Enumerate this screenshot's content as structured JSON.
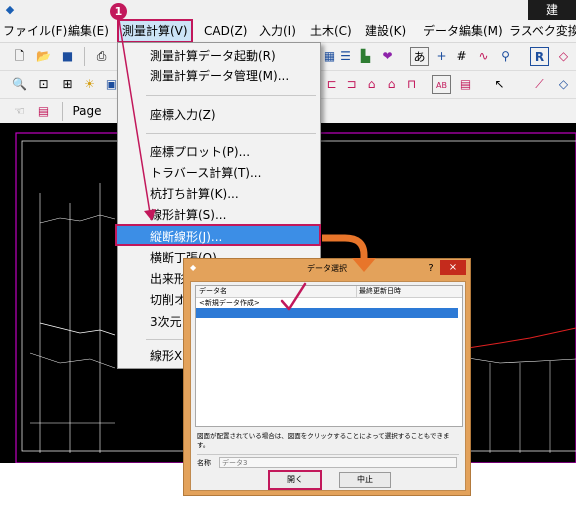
{
  "badge": "1",
  "title_fragment": "建",
  "menubar": [
    {
      "label": "ファイル(F)"
    },
    {
      "label": "編集(E)"
    },
    {
      "label": "測量計算(V)"
    },
    {
      "label": "CAD(Z)"
    },
    {
      "label": "入力(I)"
    },
    {
      "label": "土木(C)"
    },
    {
      "label": "建設(K)"
    },
    {
      "label": "データ編集(M)"
    },
    {
      "label": "ラスベク変換("
    }
  ],
  "toolbar3": {
    "page_label": "Page"
  },
  "dropdown": [
    {
      "label": "測量計算データ起動(R)"
    },
    {
      "label": "測量計算データ管理(M)..."
    },
    {
      "label": "座標入力(Z)"
    },
    {
      "label": "座標プロット(P)..."
    },
    {
      "label": "トラバース計算(T)..."
    },
    {
      "label": "杭打ち計算(K)..."
    },
    {
      "label": "線形計算(S)..."
    },
    {
      "label": "縦断線形(J)..."
    },
    {
      "label": "横断丁張(O)..."
    },
    {
      "label": "出来形"
    },
    {
      "label": "切削オ"
    },
    {
      "label": "3次元"
    },
    {
      "label": "線形X"
    }
  ],
  "dialog": {
    "title": "データ選択",
    "help": "?",
    "close": "×",
    "col_name": "データ名",
    "col_date": "最終更新日時",
    "rows": [
      {
        "name": "<新規データ作成>",
        "date": ""
      },
      {
        "name": "",
        "date": ""
      },
      {
        "name": "",
        "date": ""
      }
    ],
    "hint": "図面が配置されている場合は、図面をクリックすることによって選択することもできます。",
    "name_label": "名称",
    "name_value": "データ3",
    "open_label": "開く",
    "cancel_label": "中止"
  }
}
